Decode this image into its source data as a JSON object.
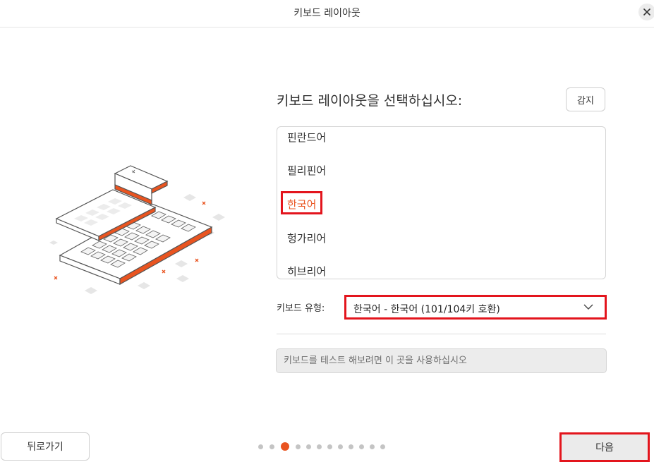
{
  "window": {
    "title": "키보드 레이아웃",
    "close_icon": "close-icon"
  },
  "main": {
    "heading": "키보드 레이아웃을 선택하십시오:",
    "detect_label": "감지",
    "languages": [
      "핀란드어",
      "필리핀어",
      "한국어",
      "헝가리어",
      "히브리어"
    ],
    "selected_language": "한국어",
    "keyboard_type_label": "키보드 유형:",
    "keyboard_type_value": "한국어 - 한국어 (101/104키 호환)",
    "test_placeholder": "키보드를 테스트 해보려면 이 곳을 사용하십시오"
  },
  "footer": {
    "back_label": "뒤로가기",
    "next_label": "다음",
    "step_current": 3,
    "step_total": 12
  },
  "colors": {
    "accent": "#e95420",
    "highlight_box": "#e3151d"
  }
}
